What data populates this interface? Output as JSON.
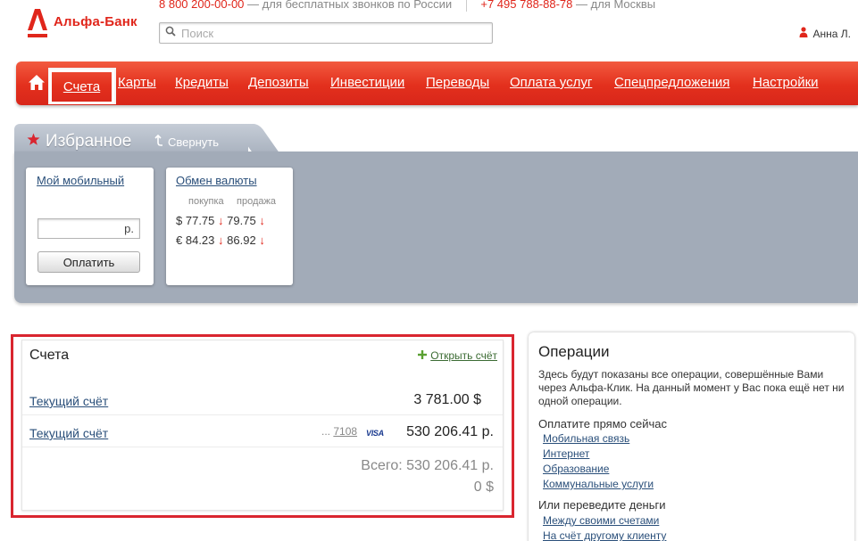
{
  "header": {
    "logo_text": "Альфа-Банк",
    "phone_free": "8 800 200-00-00",
    "phone_free_note": "— для бесплатных звонков по России",
    "phone_moscow": "+7 495 788-88-78",
    "phone_moscow_note": "— для Москвы",
    "search_placeholder": "Поиск",
    "user_name": "Анна Л."
  },
  "nav": {
    "items": [
      {
        "label": "Счета",
        "active": true
      },
      {
        "label": "Карты"
      },
      {
        "label": "Кредиты"
      },
      {
        "label": "Депозиты"
      },
      {
        "label": "Инвестиции"
      },
      {
        "label": "Переводы"
      },
      {
        "label": "Оплата услуг"
      },
      {
        "label": "Спецпредложения"
      },
      {
        "label": "Настройки"
      }
    ]
  },
  "favorites": {
    "title": "Избранное",
    "collapse_label": "Свернуть",
    "mobile": {
      "title": "Мой мобильный",
      "currency_suffix": "р.",
      "pay_label": "Оплатить"
    },
    "fx": {
      "title": "Обмен валюты",
      "col_buy": "покупка",
      "col_sell": "продажа",
      "rows": [
        {
          "symbol": "$",
          "buy": "77.75",
          "buy_arrow": "↓",
          "sell": "79.75",
          "sell_arrow": "↓"
        },
        {
          "symbol": "€",
          "buy": "84.23",
          "buy_arrow": "↓",
          "sell": "86.92",
          "sell_arrow": "↓"
        }
      ]
    }
  },
  "accounts": {
    "title": "Счета",
    "open_label": "Открыть счёт",
    "rows": [
      {
        "name": "Текущий счёт",
        "amount": "3 781.00 $"
      },
      {
        "name": "Текущий счёт",
        "card_prefix": "...",
        "card_num": "7108",
        "card_brand": "VISA",
        "amount": "530 206.41 р."
      }
    ],
    "total_label": "Всего:",
    "total_rub": "530 206.41 р.",
    "total_usd": "0 $"
  },
  "operations": {
    "title": "Операции",
    "description": "Здесь будут показаны все операции, совершённые Вами через Альфа-Клик. На данный момент у Вас пока ещё нет ни одной операции.",
    "pay_now_title": "Оплатите прямо сейчас",
    "pay_links": [
      "Мобильная связь",
      "Интернет",
      "Образование",
      "Коммунальные услуги"
    ],
    "transfer_title": "Или переведите деньги",
    "transfer_links": [
      "Между своими счетами",
      "На счёт другому клиенту"
    ]
  },
  "colors": {
    "brand_red": "#e0261b",
    "nav_red": "#e3301d",
    "link_blue": "#2a4f7a",
    "panel_gray": "#a2abb8",
    "highlight_red": "#d9252f"
  }
}
